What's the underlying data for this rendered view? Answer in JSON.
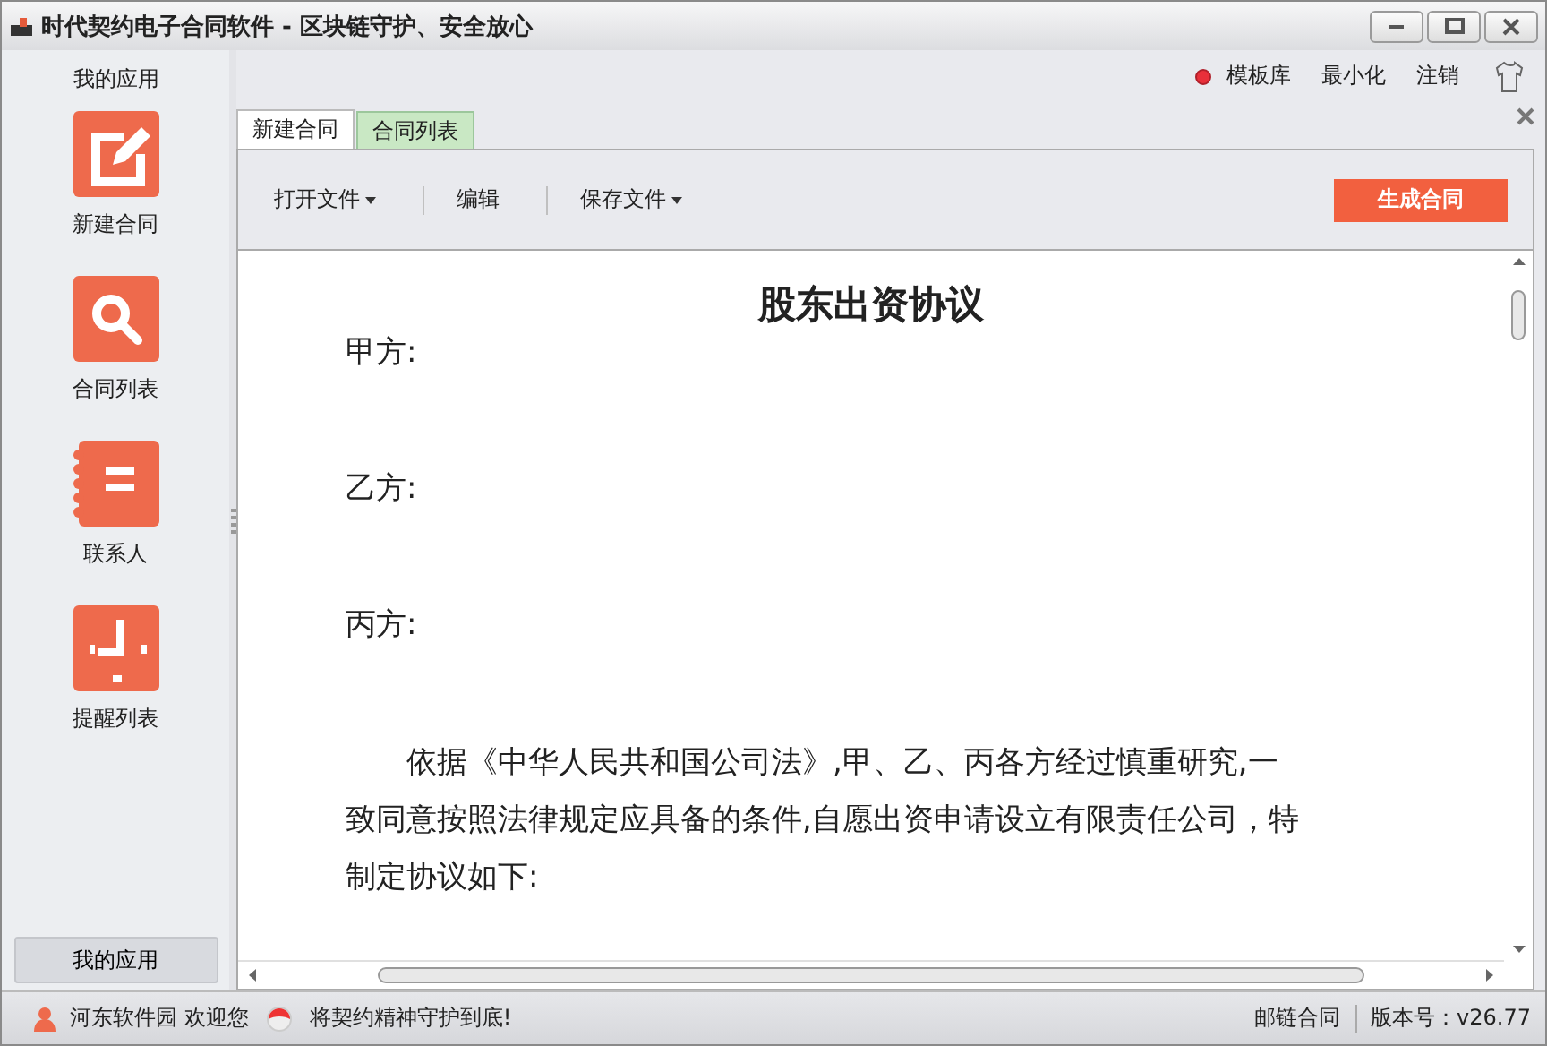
{
  "window": {
    "title": "时代契约电子合同软件 - 区块链守护、安全放心"
  },
  "sidebar": {
    "heading": "我的应用",
    "items": [
      {
        "label": "新建合同",
        "kind": "edit"
      },
      {
        "label": "合同列表",
        "kind": "search"
      },
      {
        "label": "联系人",
        "kind": "notebook"
      },
      {
        "label": "提醒列表",
        "kind": "clock"
      }
    ],
    "footer": "我的应用"
  },
  "header_links": [
    "模板库",
    "最小化",
    "注销"
  ],
  "tabs": [
    {
      "label": "新建合同",
      "selected": true
    },
    {
      "label": "合同列表",
      "selected": false
    }
  ],
  "toolbar": {
    "items": [
      {
        "label": "打开文件",
        "dropdown": true
      },
      {
        "label": "编辑",
        "dropdown": false
      },
      {
        "label": "保存文件",
        "dropdown": true
      }
    ],
    "action": "生成合同"
  },
  "document": {
    "title": "股东出资协议",
    "parties": [
      "甲方:",
      "乙方:",
      "丙方:"
    ],
    "paragraph": "依据《中华人民共和国公司法》,甲、乙、丙各方经过慎重研究,一致同意按照法律规定应具备的条件,自愿出资申请设立有限责任公司，特制定协议如下:"
  },
  "status_bar": {
    "user": "河东软件园 欢迎您",
    "slogan": "将契约精神守护到底!",
    "chain": "邮链合同",
    "version": "版本号：v26.77"
  }
}
